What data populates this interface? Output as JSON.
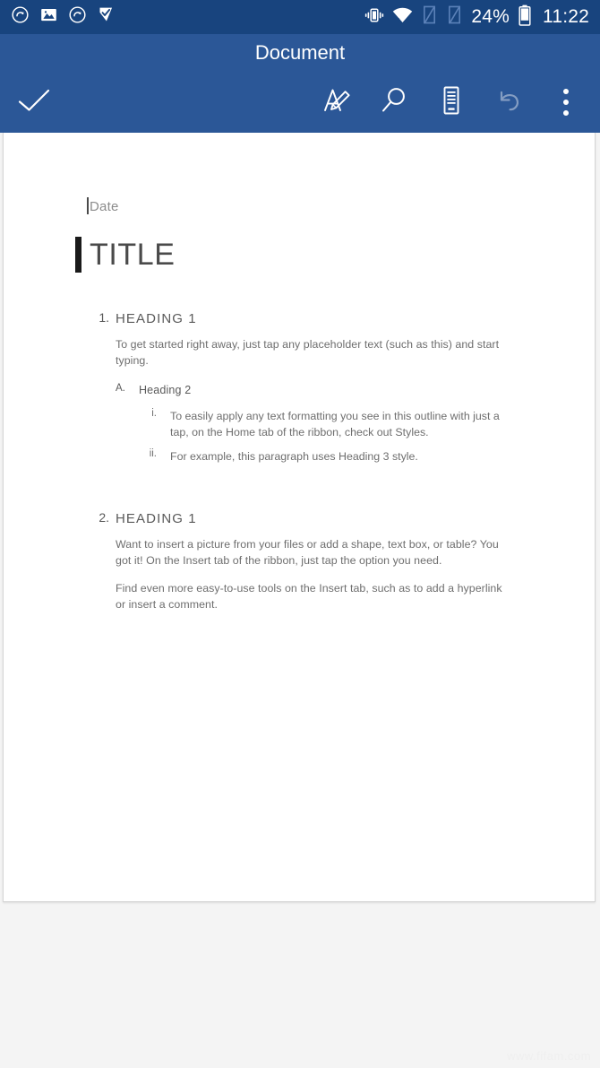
{
  "status_bar": {
    "icons_left": [
      "sync-circle-icon",
      "image-icon",
      "sync-circle-icon-2",
      "flag-check-icon"
    ],
    "icons_right": [
      "vibrate-icon",
      "wifi-icon",
      "sim-1-off-icon",
      "sim-2-off-icon"
    ],
    "battery_percent": "24%",
    "battery_icon": "battery-icon",
    "time": "11:22",
    "background_color": "#18447e"
  },
  "header": {
    "title": "Document",
    "background_color": "#2b5797",
    "toolbar": {
      "done_label": "done-checkmark",
      "format_label": "format-text",
      "search_label": "search",
      "read_view_label": "reading-view",
      "undo_label": "undo",
      "undo_disabled": true,
      "more_label": "more-options"
    }
  },
  "document": {
    "date_placeholder": "Date",
    "title": "TITLE",
    "sections": [
      {
        "number": "1.",
        "heading": "HEADING 1",
        "paragraphs": [
          "To get started right away, just tap any placeholder text (such as this) and start typing."
        ],
        "sub": {
          "number": "A.",
          "heading": "Heading 2",
          "items": [
            {
              "number": "i.",
              "text": "To easily apply any text formatting you see in this outline with just a tap, on the Home tab of the ribbon, check out Styles."
            },
            {
              "number": "ii.",
              "text": "For example, this paragraph uses Heading 3 style."
            }
          ]
        }
      },
      {
        "number": "2.",
        "heading": "HEADING 1",
        "paragraphs": [
          "Want to insert a picture from your files or add a shape, text box, or table? You got it! On the Insert tab of the ribbon, just tap the option you need.",
          "Find even more easy-to-use tools on the Insert tab, such as to add a hyperlink or insert a comment."
        ]
      }
    ]
  },
  "watermark": {
    "text": "www.fifam.com"
  }
}
